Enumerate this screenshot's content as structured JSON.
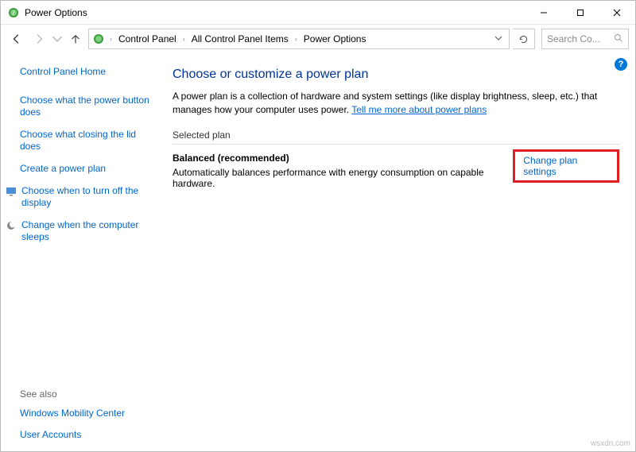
{
  "window": {
    "title": "Power Options"
  },
  "breadcrumb": {
    "items": [
      "Control Panel",
      "All Control Panel Items",
      "Power Options"
    ]
  },
  "search": {
    "placeholder": "Search Co..."
  },
  "sidebar": {
    "home": "Control Panel Home",
    "links": {
      "power_button": "Choose what the power button does",
      "closing_lid": "Choose what closing the lid does",
      "create_plan": "Create a power plan",
      "turn_off_display": "Choose when to turn off the display",
      "computer_sleeps": "Change when the computer sleeps"
    },
    "see_also": {
      "title": "See also",
      "mobility": "Windows Mobility Center",
      "accounts": "User Accounts"
    }
  },
  "main": {
    "heading": "Choose or customize a power plan",
    "description": "A power plan is a collection of hardware and system settings (like display brightness, sleep, etc.) that manages how your computer uses power. ",
    "tell_me_more": "Tell me more about power plans",
    "section_label": "Selected plan",
    "plan_name": "Balanced (recommended)",
    "plan_desc": "Automatically balances performance with energy consumption on capable hardware.",
    "change_link": "Change plan settings"
  },
  "watermark": "wsxdn.com"
}
